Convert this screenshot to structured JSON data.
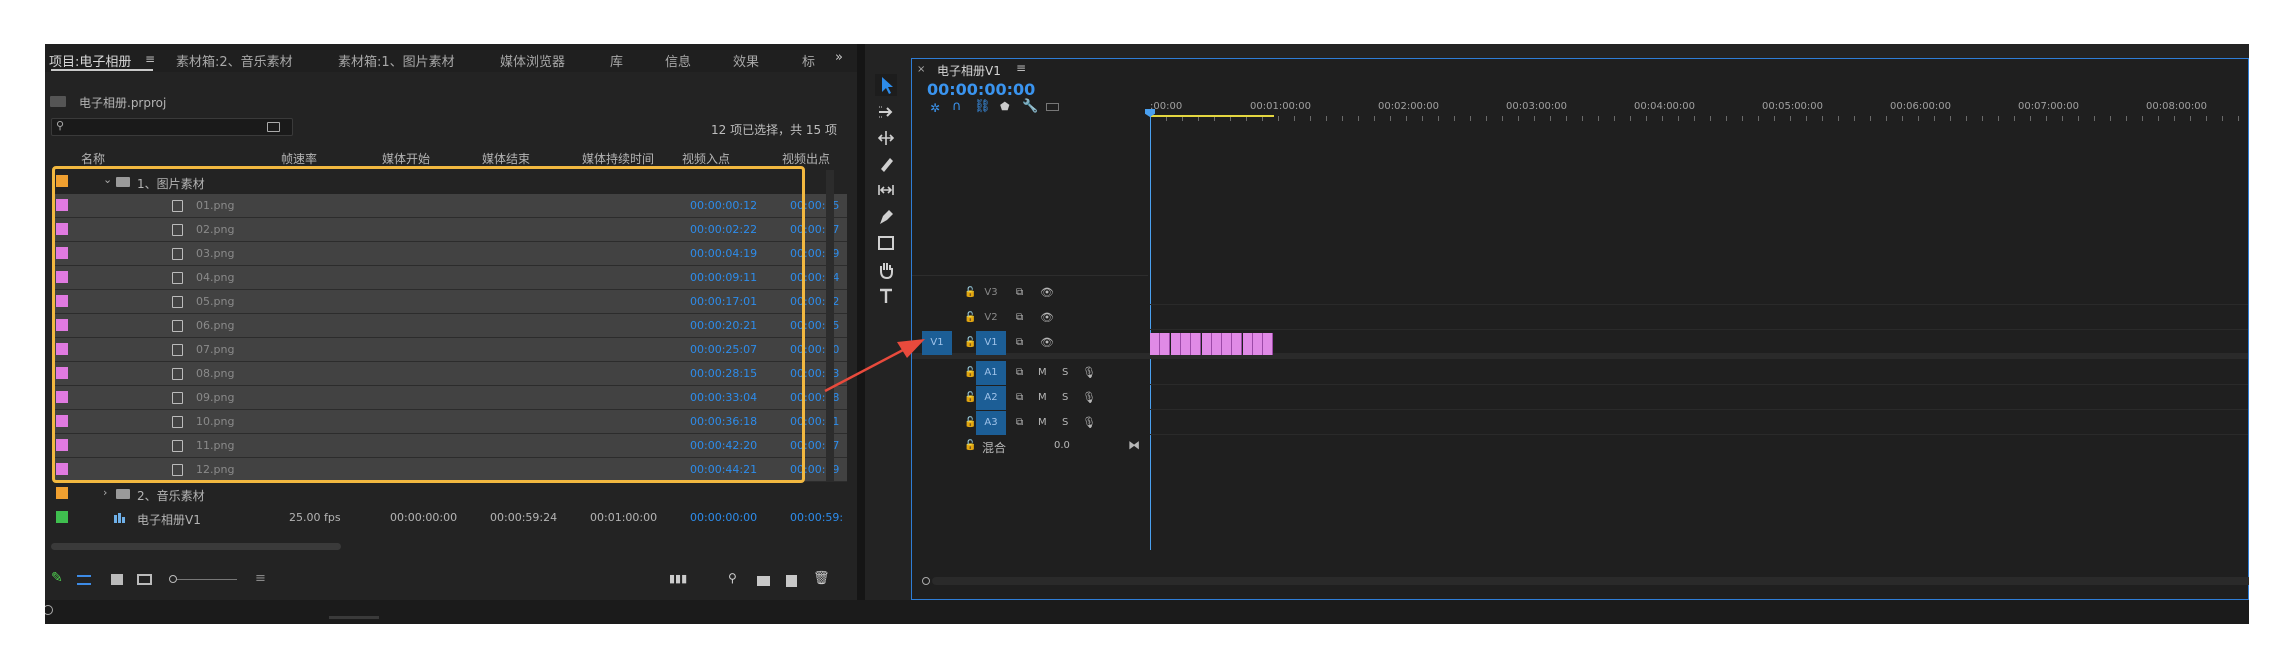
{
  "project": {
    "tabs": [
      "项目:电子相册",
      "素材箱:2、音乐素材",
      "素材箱:1、图片素材",
      "媒体浏览器",
      "库",
      "信息",
      "效果",
      "标"
    ],
    "file": "电子相册.prproj",
    "search_placeholder": "",
    "selection_status": "12 项已选择，共 15 项",
    "columns": [
      "名称",
      "帧速率",
      "媒体开始",
      "媒体结束",
      "媒体持续时间",
      "视频入点",
      "视频出点"
    ],
    "folder1": {
      "name": "1、图片素材",
      "color": "#f0a030"
    },
    "items": [
      {
        "name": "01.png",
        "in": "00:00:00:12",
        "out": "00:00:05"
      },
      {
        "name": "02.png",
        "in": "00:00:02:22",
        "out": "00:00:07"
      },
      {
        "name": "03.png",
        "in": "00:00:04:19",
        "out": "00:00:09"
      },
      {
        "name": "04.png",
        "in": "00:00:09:11",
        "out": "00:00:14"
      },
      {
        "name": "05.png",
        "in": "00:00:17:01",
        "out": "00:00:22"
      },
      {
        "name": "06.png",
        "in": "00:00:20:21",
        "out": "00:00:25"
      },
      {
        "name": "07.png",
        "in": "00:00:25:07",
        "out": "00:00:30"
      },
      {
        "name": "08.png",
        "in": "00:00:28:15",
        "out": "00:00:33"
      },
      {
        "name": "09.png",
        "in": "00:00:33:04",
        "out": "00:00:38"
      },
      {
        "name": "10.png",
        "in": "00:00:36:18",
        "out": "00:00:41"
      },
      {
        "name": "11.png",
        "in": "00:00:42:20",
        "out": "00:00:47"
      },
      {
        "name": "12.png",
        "in": "00:00:44:21",
        "out": "00:00:49"
      }
    ],
    "item_color": "#e07ae0",
    "folder2": {
      "name": "2、音乐素材",
      "color": "#f0a030"
    },
    "sequence": {
      "name": "电子相册V1",
      "fps": "25.00 fps",
      "start": "00:00:00:00",
      "end": "00:00:59:24",
      "duration": "00:01:00:00",
      "in": "00:00:00:00",
      "out": "00:00:59:",
      "color": "#3fbf4f"
    }
  },
  "timeline": {
    "tab_title": "电子相册V1",
    "timecode": "00:00:00:00",
    "ruler": [
      ":00:00",
      "00:01:00:00",
      "00:02:00:00",
      "00:03:00:00",
      "00:04:00:00",
      "00:05:00:00",
      "00:06:00:00",
      "00:07:00:00",
      "00:08:00:00"
    ],
    "video_tracks": [
      "V3",
      "V2",
      "V1"
    ],
    "audio_tracks": [
      "A1",
      "A2",
      "A3"
    ],
    "source_patch": "V1",
    "mix_label": "混合",
    "mix_value": "0.0",
    "m_label": "M",
    "s_label": "S",
    "clip_count": 12,
    "clip_color": "#e08ae6"
  }
}
